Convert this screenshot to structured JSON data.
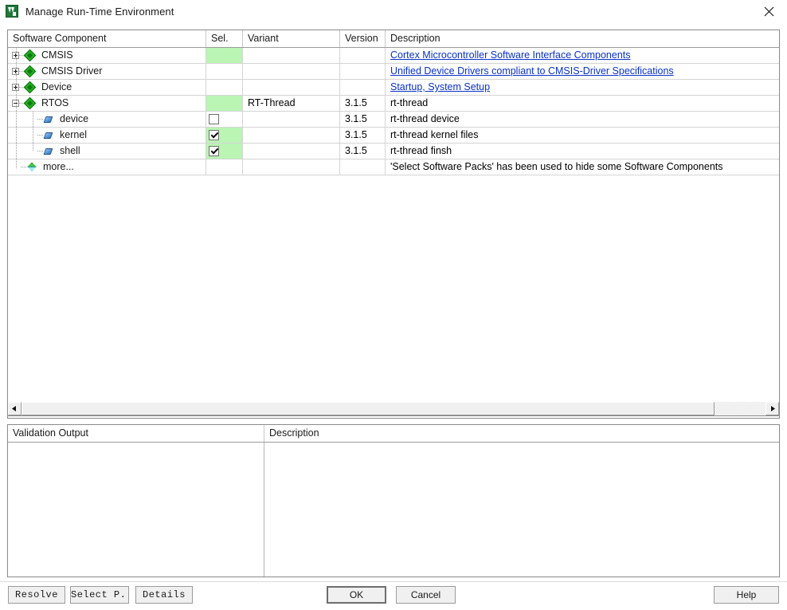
{
  "window": {
    "title": "Manage Run-Time Environment",
    "app_icon": "keil-uvision-icon",
    "close_label": "✕"
  },
  "tree_table": {
    "columns": [
      {
        "key": "name",
        "label": "Software Component"
      },
      {
        "key": "sel",
        "label": "Sel."
      },
      {
        "key": "variant",
        "label": "Variant"
      },
      {
        "key": "version",
        "label": "Version"
      },
      {
        "key": "desc",
        "label": "Description"
      }
    ],
    "rows": [
      {
        "name": "CMSIS",
        "indent": 0,
        "expander": "plus",
        "icon": "green-diamond-icon",
        "sel_state": "green-empty",
        "variant": "",
        "version": "",
        "desc": "Cortex Microcontroller Software Interface Components",
        "desc_is_link": true
      },
      {
        "name": "CMSIS Driver",
        "indent": 0,
        "expander": "plus",
        "icon": "green-diamond-icon",
        "sel_state": "empty",
        "variant": "",
        "version": "",
        "desc": "Unified Device Drivers compliant to CMSIS-Driver Specifications",
        "desc_is_link": true
      },
      {
        "name": "Device",
        "indent": 0,
        "expander": "plus",
        "icon": "green-diamond-icon",
        "sel_state": "empty",
        "variant": "",
        "version": "",
        "desc": "Startup, System Setup",
        "desc_is_link": true
      },
      {
        "name": "RTOS",
        "indent": 0,
        "expander": "minus",
        "icon": "green-diamond-icon",
        "sel_state": "green-empty",
        "variant": "RT-Thread",
        "version": "3.1.5",
        "desc": "rt-thread",
        "desc_is_link": false
      },
      {
        "name": "device",
        "indent": 1,
        "expander": "none",
        "icon": "blue-diamond-icon",
        "sel_state": "unchecked",
        "variant": "",
        "version": "3.1.5",
        "desc": "rt-thread device",
        "desc_is_link": false
      },
      {
        "name": "kernel",
        "indent": 1,
        "expander": "none",
        "icon": "blue-diamond-icon",
        "sel_state": "checked",
        "variant": "",
        "version": "3.1.5",
        "desc": "rt-thread kernel files",
        "desc_is_link": false
      },
      {
        "name": "shell",
        "indent": 1,
        "expander": "none",
        "icon": "blue-diamond-icon",
        "sel_state": "checked",
        "variant": "",
        "version": "3.1.5",
        "desc": "rt-thread finsh",
        "desc_is_link": false
      },
      {
        "name": "more...",
        "indent": 0,
        "expander": "none",
        "icon": "more-diamond-icon",
        "sel_state": "empty",
        "variant": "",
        "version": "",
        "desc": "'Select Software Packs' has been used to hide some Software Components",
        "desc_is_link": false
      }
    ]
  },
  "scrollbar": {
    "left_arrow": "scroll-left-icon",
    "right_arrow": "scroll-right-icon"
  },
  "validation": {
    "columns": [
      {
        "key": "output",
        "label": "Validation Output"
      },
      {
        "key": "desc",
        "label": "Description"
      }
    ],
    "rows": []
  },
  "buttons": {
    "resolve": "Resolve",
    "select_packs": "Select P...",
    "details": "Details",
    "ok": "OK",
    "cancel": "Cancel",
    "help": "Help"
  },
  "colors": {
    "selected_green": "#baf5b4",
    "link_blue": "#0a32c8",
    "panel_border": "#8a8a8a"
  }
}
